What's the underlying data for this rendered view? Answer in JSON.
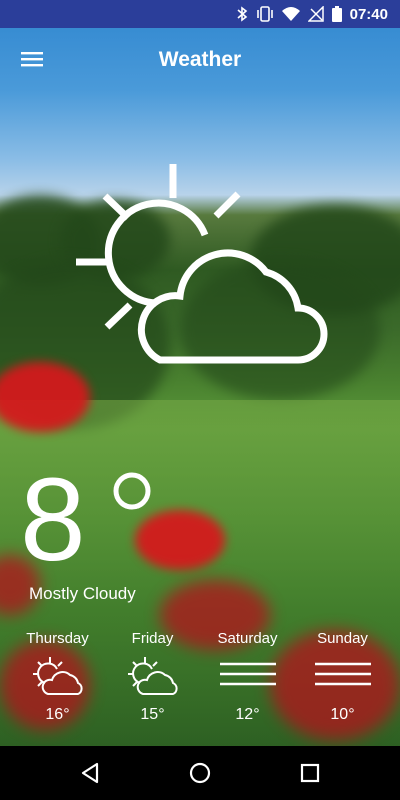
{
  "status_bar": {
    "time": "07:40",
    "icons": [
      "bluetooth-icon",
      "vibrate-icon",
      "wifi-icon",
      "no-signal-icon",
      "battery-icon"
    ]
  },
  "app_bar": {
    "title": "Weather",
    "menu_icon": "hamburger-menu-icon"
  },
  "current": {
    "temperature": "8",
    "unit": "°",
    "condition": "Mostly Cloudy",
    "icon": "partly-cloudy-icon"
  },
  "forecast": [
    {
      "day": "Thursday",
      "icon": "partly-cloudy-icon",
      "temp": "16°"
    },
    {
      "day": "Friday",
      "icon": "partly-cloudy-icon",
      "temp": "15°"
    },
    {
      "day": "Saturday",
      "icon": "fog-icon",
      "temp": "12°"
    },
    {
      "day": "Sunday",
      "icon": "fog-icon",
      "temp": "10°"
    }
  ],
  "nav_bar": {
    "icons": [
      "back-icon",
      "home-icon",
      "recents-icon"
    ]
  },
  "colors": {
    "status_bar": "#2b3e9a",
    "sky": "#2f86cf",
    "grass": "#4e8d33",
    "poppy": "#d8171c",
    "nav_bar": "#000000"
  }
}
